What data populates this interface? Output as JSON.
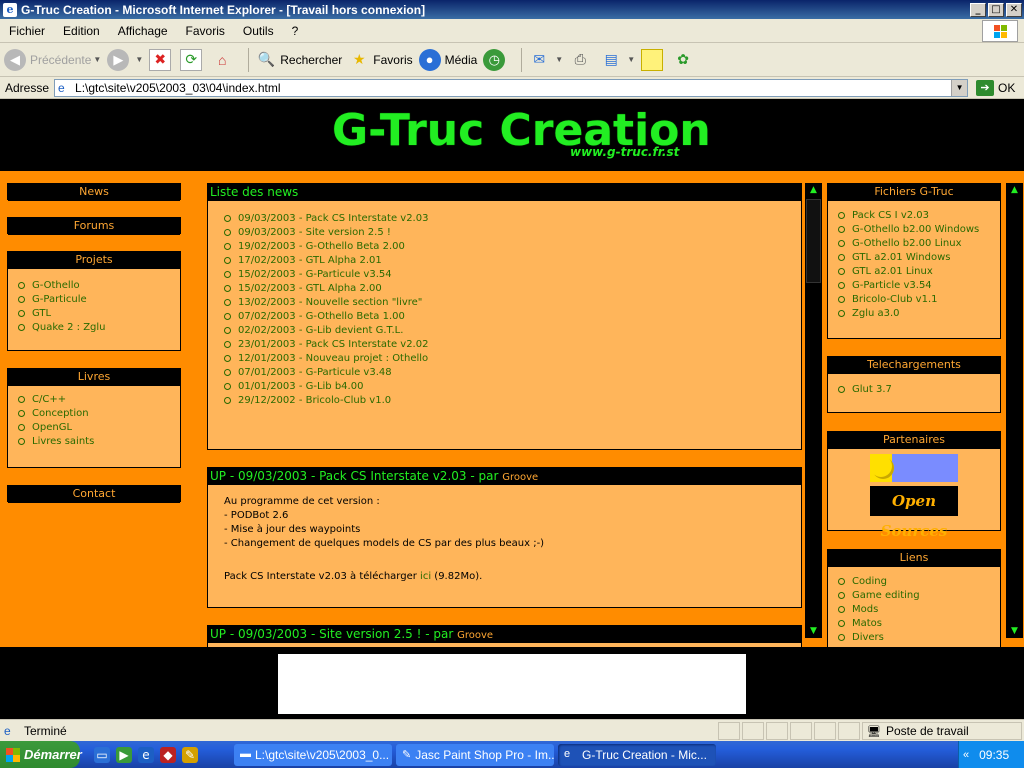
{
  "window": {
    "title": "G-Truc Creation - Microsoft Internet Explorer - [Travail hors connexion]",
    "buttons": [
      "_",
      "□",
      "✕"
    ]
  },
  "menu": [
    "Fichier",
    "Edition",
    "Affichage",
    "Favoris",
    "Outils",
    "?"
  ],
  "toolbar": {
    "back_label": "Précédente",
    "search_label": "Rechercher",
    "favorites_label": "Favoris",
    "media_label": "Média"
  },
  "address": {
    "label": "Adresse",
    "url": "L:\\gtc\\site\\v205\\2003_03\\04\\index.html",
    "go_label": "OK"
  },
  "site": {
    "logo": "G-Truc Creation",
    "logo_url": "www.g-truc.fr.st"
  },
  "left_nav": {
    "news": "News",
    "forums": "Forums",
    "projets_title": "Projets",
    "projets": [
      "G-Othello",
      "G-Particule",
      "GTL",
      "Quake 2 : Zglu"
    ],
    "livres_title": "Livres",
    "livres": [
      "C/C++",
      "Conception",
      "OpenGL",
      "Livres saints"
    ],
    "contact": "Contact"
  },
  "news_list": {
    "title": "Liste des news",
    "items": [
      "09/03/2003 - Pack CS Interstate v2.03",
      "09/03/2003 - Site version 2.5 !",
      "19/02/2003 - G-Othello Beta 2.00",
      "17/02/2003 - GTL Alpha 2.01",
      "15/02/2003 - G-Particule v3.54",
      "15/02/2003 - GTL Alpha 2.00",
      "13/02/2003 - Nouvelle section \"livre\"",
      "07/02/2003 - G-Othello Beta 1.00",
      "02/02/2003 - G-Lib devient G.T.L.",
      "23/01/2003 - Pack CS Interstate v2.02",
      "12/01/2003 - Nouveau projet : Othello",
      "07/01/2003 - G-Particule v3.48",
      "01/01/2003 - G-Lib b4.00",
      "29/12/2002 - Bricolo-Club v1.0"
    ]
  },
  "news_article": {
    "title": "UP - 09/03/2003 - Pack CS Interstate v2.03 - par",
    "author": "Groove",
    "intro": "Au programme de cet version :",
    "lines": [
      "- PODBot 2.6",
      "- Mise à jour des waypoints",
      "- Changement de quelques models de CS par des plus beaux ;-)"
    ],
    "download_prefix": "Pack CS Interstate v2.03 à télécharger",
    "download_link": "ici",
    "download_size": "(9.82Mo)."
  },
  "news_article2": {
    "title": "UP - 09/03/2003 - Site version 2.5 ! - par",
    "author": "Groove"
  },
  "right_nav": {
    "fichiers_title": "Fichiers G-Truc",
    "fichiers": [
      "Pack CS I v2.03",
      "G-Othello b2.00 Windows",
      "G-Othello b2.00 Linux",
      "GTL a2.01 Windows",
      "GTL a2.01 Linux",
      "G-Particle v3.54",
      "Bricolo-Club v1.1",
      "Zglu a3.0"
    ],
    "telechargements_title": "Telechargements",
    "telechargements": [
      "Glut 3.7"
    ],
    "partenaires_title": "Partenaires",
    "partner_banner": "Open Sources",
    "liens_title": "Liens",
    "liens": [
      "Coding",
      "Game editing",
      "Mods",
      "Matos",
      "Divers"
    ]
  },
  "status": {
    "text": "Terminé",
    "zone": "Poste de travail"
  },
  "taskbar": {
    "start": "Démarrer",
    "tasks": [
      "L:\\gtc\\site\\v205\\2003_0...",
      "Jasc Paint Shop Pro - Im...",
      "G-Truc Creation - Mic..."
    ],
    "clock": "09:35"
  },
  "colors": {
    "page_bg": "#ff8c00",
    "box_bg": "#ffb55a",
    "green_text": "#22ee22",
    "link_text": "#2a6a00"
  }
}
